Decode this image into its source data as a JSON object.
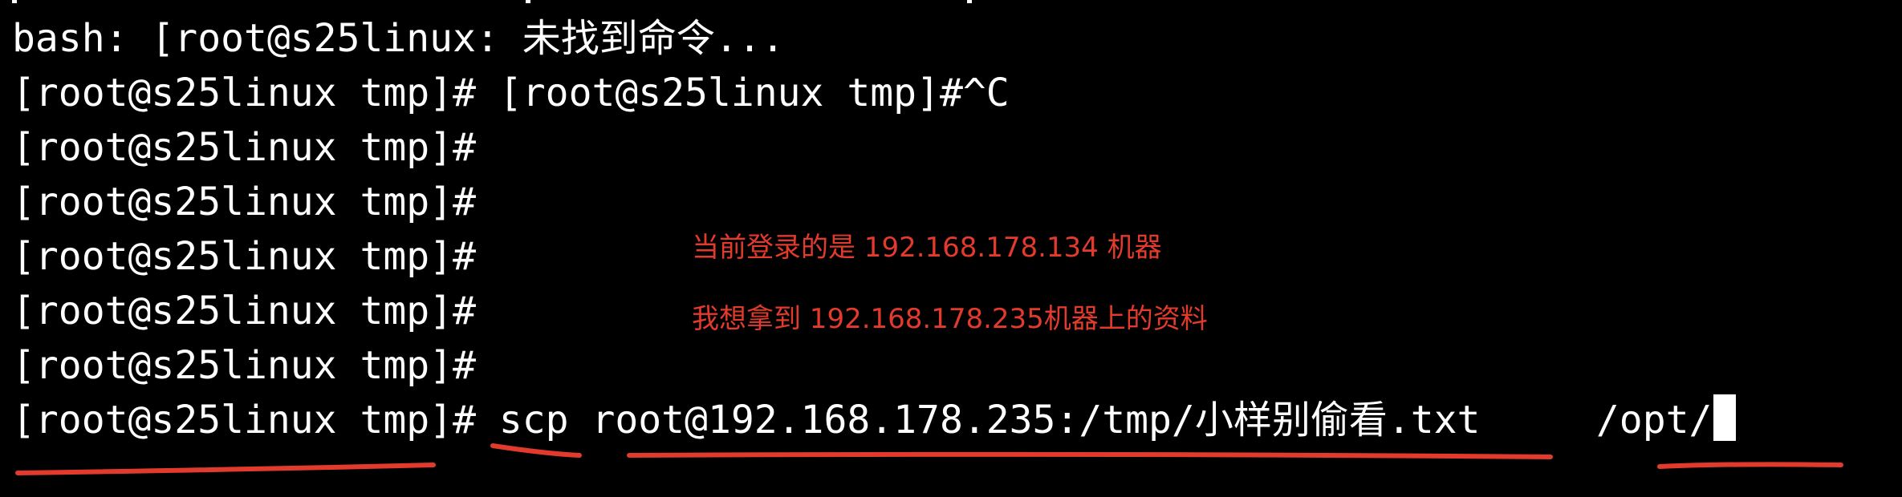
{
  "terminal": {
    "background": "#000000",
    "text_color": "#ffffff",
    "lines": [
      "bash: [root@s25linux: 未找到命令...",
      "[root@s25linux tmp]# [root@s25linux tmp]#^C",
      "[root@s25linux tmp]#",
      "[root@s25linux tmp]#",
      "[root@s25linux tmp]#",
      "[root@s25linux tmp]#",
      "[root@s25linux tmp]#"
    ],
    "command_line": {
      "prompt": "[root@s25linux tmp]#",
      "command": " scp root@192.168.178.235:/tmp/小样别偷看.txt     /opt/"
    }
  },
  "annotations": {
    "color": "#e23a2c",
    "note1": "当前登录的是 192.168.178.134 机器",
    "note2": "我想拿到 192.168.178.235机器上的资料"
  }
}
